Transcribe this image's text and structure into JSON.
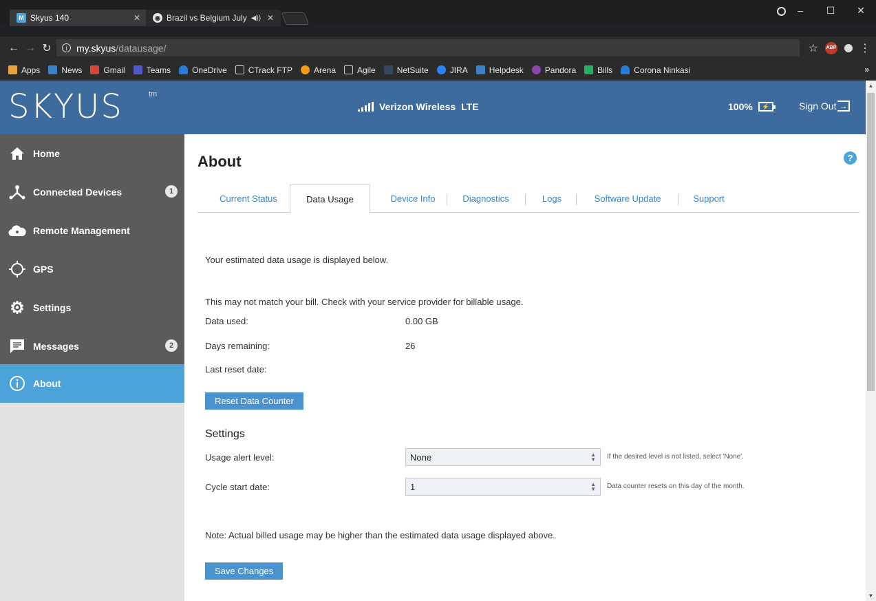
{
  "browser": {
    "tabs": [
      {
        "title": "Skyus 140",
        "favicon": "M"
      },
      {
        "title": "Brazil vs Belgium July"
      }
    ],
    "url_host": "my.skyus",
    "url_path": "/datausage/",
    "bookmarks": [
      "Apps",
      "News",
      "Gmail",
      "Teams",
      "OneDrive",
      "CTrack FTP",
      "Arena",
      "Agile",
      "NetSuite",
      "JIRA",
      "Helpdesk",
      "Pandora",
      "Bills",
      "Corona Ninkasi"
    ],
    "bookmark_more": "»"
  },
  "header": {
    "logo": "SKYUS",
    "logo_tm": "tm",
    "carrier": "Verizon Wireless",
    "network": "LTE",
    "battery": "100%",
    "signout": "Sign Out"
  },
  "sidebar": {
    "items": [
      {
        "label": "Home",
        "icon": "home-icon"
      },
      {
        "label": "Connected Devices",
        "icon": "devices-icon",
        "badge": "1"
      },
      {
        "label": "Remote Management",
        "icon": "cloud-icon"
      },
      {
        "label": "GPS",
        "icon": "gps-icon"
      },
      {
        "label": "Settings",
        "icon": "gear-icon"
      },
      {
        "label": "Messages",
        "icon": "message-icon",
        "badge": "2"
      },
      {
        "label": "About",
        "icon": "info-icon"
      }
    ]
  },
  "main": {
    "title": "About",
    "help": "?",
    "tabs": [
      "Current Status",
      "Data Usage",
      "Device Info",
      "Diagnostics",
      "Logs",
      "Software Update",
      "Support"
    ],
    "intro": "Your estimated data usage is displayed below.",
    "disclaimer": "This may not match your bill. Check with your service provider for billable usage.",
    "data_used_label": "Data used:",
    "data_used_value": "0.00 GB",
    "days_remaining_label": "Days remaining:",
    "days_remaining_value": "26",
    "last_reset_label": "Last reset date:",
    "reset_button": "Reset Data Counter",
    "settings_heading": "Settings",
    "usage_alert_label": "Usage alert level:",
    "usage_alert_value": "None",
    "usage_alert_hint": "If the desired level is not listed, select 'None'.",
    "cycle_start_label": "Cycle start date:",
    "cycle_start_value": "1",
    "cycle_start_hint": "Data counter resets on this day of the month.",
    "note": "Note: Actual billed usage may be higher than the estimated data usage displayed above.",
    "save_button": "Save Changes"
  },
  "colors": {
    "header": "#3d6b9e",
    "sidebar": "#5b5b5b",
    "active": "#4ca3d9",
    "button": "#4a93cf",
    "link": "#3a82c4"
  }
}
